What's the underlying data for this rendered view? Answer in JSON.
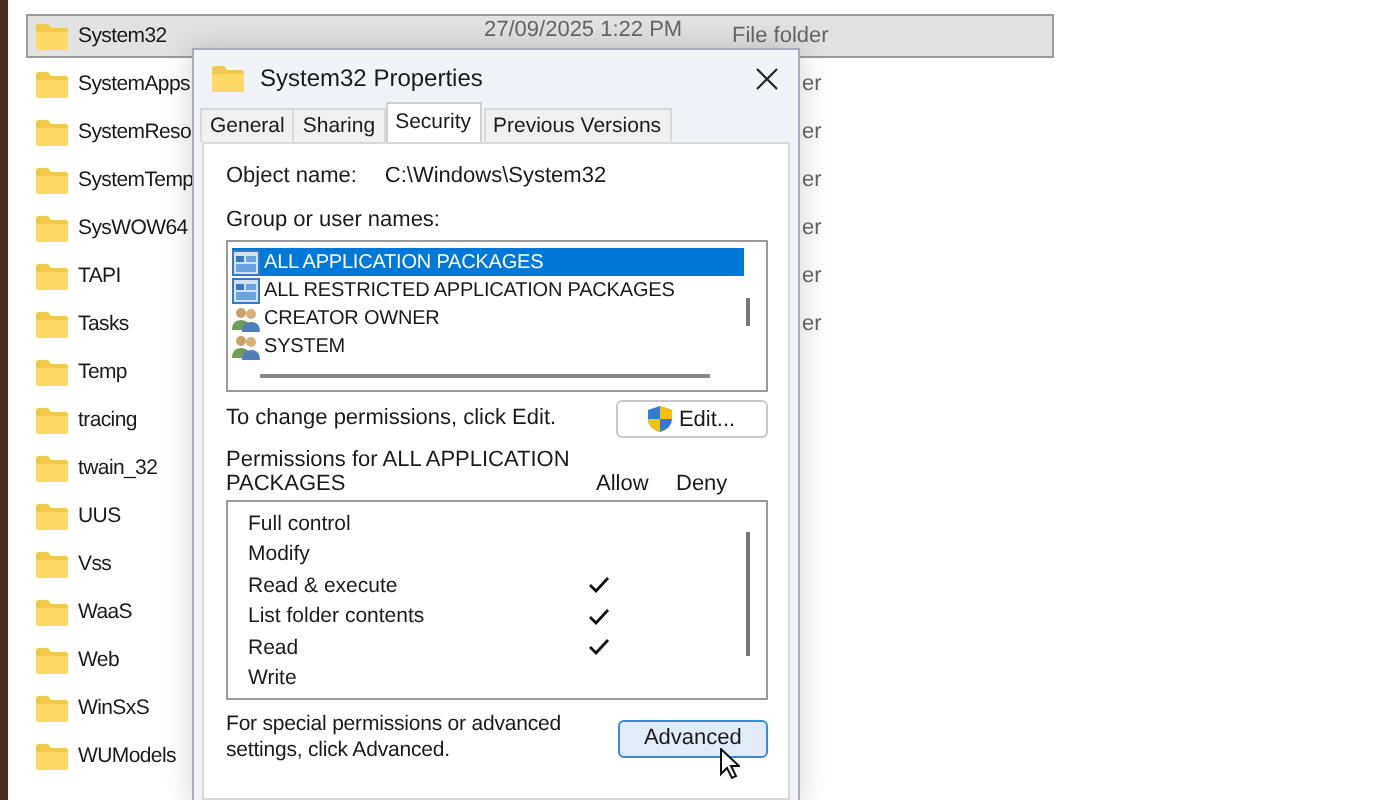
{
  "explorer": {
    "rows": [
      {
        "name": "System32",
        "date": "27/09/2025 1:22 PM",
        "type": "File folder",
        "selected": true
      },
      {
        "name": "SystemApps",
        "type": "er",
        "selected": false
      },
      {
        "name": "SystemReso",
        "type": "er",
        "selected": false
      },
      {
        "name": "SystemTemp",
        "type": "er",
        "selected": false
      },
      {
        "name": "SysWOW64",
        "type": "er",
        "selected": false
      },
      {
        "name": "TAPI",
        "type": "er",
        "selected": false
      },
      {
        "name": "Tasks",
        "type": "er",
        "selected": false
      },
      {
        "name": "Temp",
        "selected": false
      },
      {
        "name": "tracing",
        "selected": false
      },
      {
        "name": "twain_32",
        "selected": false
      },
      {
        "name": "UUS",
        "selected": false
      },
      {
        "name": "Vss",
        "selected": false
      },
      {
        "name": "WaaS",
        "selected": false
      },
      {
        "name": "Web",
        "selected": false
      },
      {
        "name": "WinSxS",
        "selected": false
      },
      {
        "name": "WUModels",
        "selected": false
      }
    ]
  },
  "dialog": {
    "title": "System32 Properties",
    "tabs": [
      {
        "label": "General",
        "selected": false
      },
      {
        "label": "Sharing",
        "selected": false
      },
      {
        "label": "Security",
        "selected": true
      },
      {
        "label": "Previous Versions",
        "selected": false
      }
    ],
    "object_label": "Object name:",
    "object_value": "C:\\Windows\\System32",
    "groups_label": "Group or user names:",
    "groups": [
      {
        "name": "ALL APPLICATION PACKAGES",
        "kind": "package",
        "selected": true
      },
      {
        "name": "ALL RESTRICTED APPLICATION PACKAGES",
        "kind": "package",
        "selected": false
      },
      {
        "name": "CREATOR OWNER",
        "kind": "user",
        "selected": false
      },
      {
        "name": "SYSTEM",
        "kind": "user",
        "selected": false
      }
    ],
    "change_text": "To change permissions, click Edit.",
    "edit_button": "Edit...",
    "permissions_label": "Permissions for ALL APPLICATION PACKAGES",
    "allow_header": "Allow",
    "deny_header": "Deny",
    "permissions": [
      {
        "name": "Full control",
        "allow": false,
        "deny": false
      },
      {
        "name": "Modify",
        "allow": false,
        "deny": false
      },
      {
        "name": "Read & execute",
        "allow": true,
        "deny": false
      },
      {
        "name": "List folder contents",
        "allow": true,
        "deny": false
      },
      {
        "name": "Read",
        "allow": true,
        "deny": false
      },
      {
        "name": "Write",
        "allow": false,
        "deny": false
      }
    ],
    "advanced_text": "For special permissions or advanced settings, click Advanced.",
    "advanced_button": "Advanced"
  }
}
